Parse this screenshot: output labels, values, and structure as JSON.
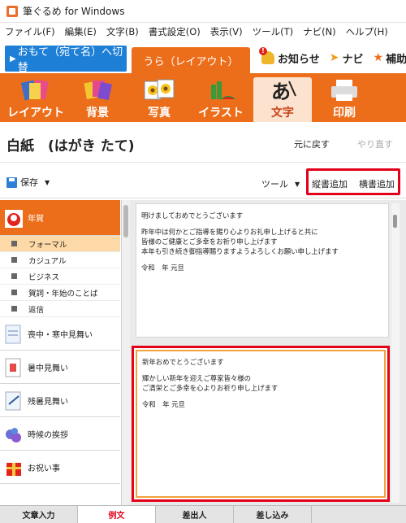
{
  "window": {
    "title": "筆ぐるめ for Windows"
  },
  "menu": [
    "ファイル(F)",
    "編集(E)",
    "文字(B)",
    "書式設定(O)",
    "表示(V)",
    "ツール(T)",
    "ナビ(N)",
    "ヘルプ(H)"
  ],
  "modes": {
    "front_label": "おもて（宛て名）へ切替",
    "back_label": "うら（レイアウト）",
    "notice_label": "お知らせ",
    "notice_badge": "!",
    "navi_label": "ナビ",
    "extra_label": "補助"
  },
  "ribbon": {
    "items": [
      {
        "label": "レイアウト"
      },
      {
        "label": "背景"
      },
      {
        "label": "写真"
      },
      {
        "label": "イラスト"
      },
      {
        "label": "文字"
      },
      {
        "label": "印刷"
      }
    ],
    "active": "文字",
    "accent": "#ec6e1a"
  },
  "document": {
    "title": "白紙　(はがき たて)",
    "undo_label": "元に戻す",
    "redo_label": "やり直す"
  },
  "toolbar": {
    "save_label": "保存",
    "tools_label": "ツール",
    "add_vertical_label": "縦書追加",
    "add_horizontal_label": "横書追加"
  },
  "categories": {
    "selected": {
      "label": "年賀"
    },
    "subitems": [
      {
        "label": "フォーマル"
      },
      {
        "label": "カジュアル"
      },
      {
        "label": "ビジネス"
      },
      {
        "label": "賀詞・年始のことば"
      },
      {
        "label": "返信"
      }
    ],
    "others": [
      {
        "label": "喪中・寒中見舞い"
      },
      {
        "label": "暑中見舞い"
      },
      {
        "label": "残暑見舞い"
      },
      {
        "label": "時候の挨拶"
      },
      {
        "label": "お祝い事"
      }
    ]
  },
  "previews": [
    {
      "lines": [
        "明けましておめでとうございます",
        "",
        "昨年中は何かとご指導を賜り心よりお礼申し上げると共に",
        "皆様のご健康とご多幸をお祈り申し上げます",
        "本年も引き続き御指導賜りますようよろしくお願い申し上げます",
        "",
        "令和　年 元旦"
      ]
    },
    {
      "lines": [
        "新年おめでとうございます",
        "",
        "輝かしい新年を迎えご尊家皆々様の",
        "ご清栄とご多幸を心よりお祈り申し上げます",
        "",
        "令和　年 元旦"
      ]
    }
  ],
  "bottom_tabs": [
    {
      "label": "文章入力"
    },
    {
      "label": "例文"
    },
    {
      "label": "差出人"
    },
    {
      "label": "差し込み"
    }
  ],
  "bottom_active": "例文"
}
